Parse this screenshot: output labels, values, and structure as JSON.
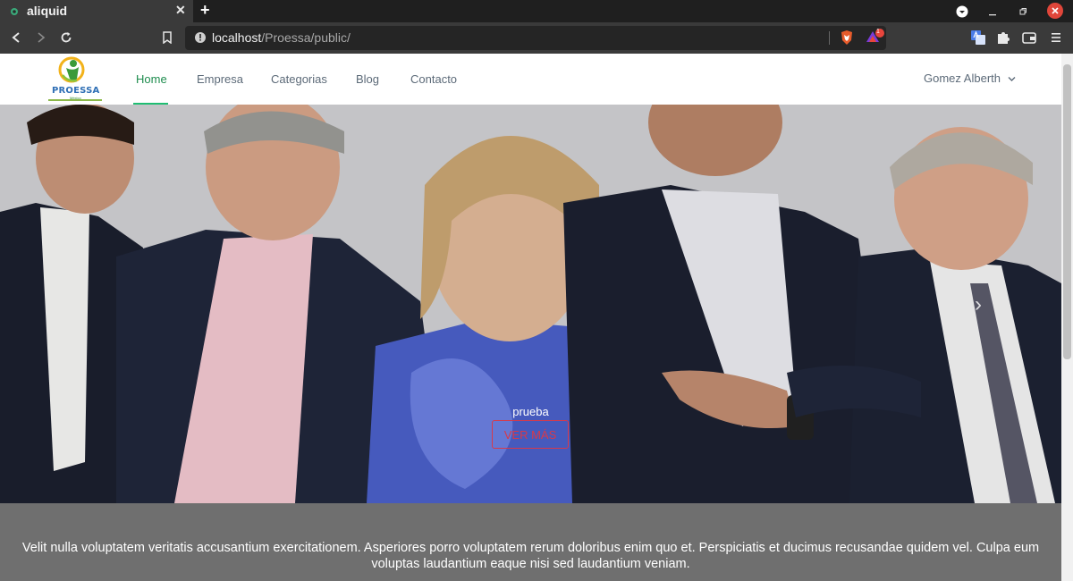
{
  "browser": {
    "tab_title": "aliquid",
    "tab_close": "✕",
    "new_tab": "+",
    "url_host": "localhost",
    "url_path": "/Proessa/public/",
    "brave_badge_count": "1"
  },
  "site": {
    "logo_text": "PROESSA",
    "logo_sub": "México",
    "nav": [
      {
        "label": "Home",
        "active": true
      },
      {
        "label": "Empresa"
      },
      {
        "label": "Categorias"
      },
      {
        "label": "Blog"
      },
      {
        "label": "Contacto"
      }
    ],
    "user_name": "Gomez Alberth"
  },
  "hero": {
    "caption": "prueba",
    "button_label": "VER MÁS",
    "next_arrow": "›"
  },
  "description": {
    "text": "Velit nulla voluptatem veritatis accusantium exercitationem. Asperiores porro voluptatem rerum doloribus enim quo et. Perspiciatis et ducimus recusandae quidem vel. Culpa eum voluptas laudantium eaque nisi sed laudantium veniam."
  },
  "colors": {
    "nav_active": "#1e8c4e",
    "nav_underline": "#1fbd72",
    "button_accent": "#d63a4b",
    "description_bg": "#6f6f6f"
  }
}
